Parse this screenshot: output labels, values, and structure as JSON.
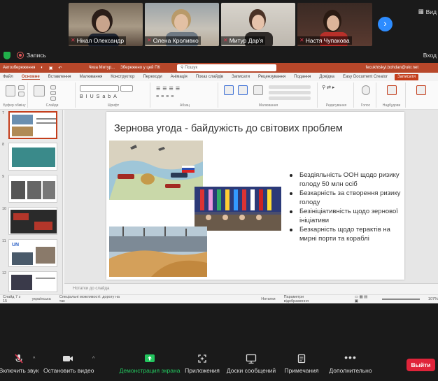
{
  "participants": [
    {
      "name": "Нікал Олександр",
      "muted": true
    },
    {
      "name": "Олена Кроливко",
      "muted": true
    },
    {
      "name": "Митур Дар'я",
      "muted": true
    },
    {
      "name": "Настя Чупакова",
      "muted": true
    }
  ],
  "view_label": "Вид",
  "record_label": "Запись",
  "exit_label": "Вход",
  "ppt": {
    "title_left": "Автозбереження",
    "doc_title": "Чиза Митур...",
    "save_loc": "Збережено у цей ПК",
    "search_placeholder": "Пошук",
    "user": "fecukhtskyi.bohdan@ukr.net",
    "menu": [
      "Файл",
      "Основне",
      "Вставлення",
      "Малювання",
      "Конструктор",
      "Переходи",
      "Анімація",
      "Показ слайдів",
      "Записати",
      "Рецензування",
      "Подання",
      "Довідка",
      "Easy Document Creator"
    ],
    "active_menu": "Основне",
    "share": "Записати",
    "ribbon_groups": [
      "Буфер обміну",
      "Слайди",
      "Шрифт",
      "Абзац",
      "Малювання",
      "Редагування",
      "Голос",
      "Надбудови"
    ],
    "thumb_numbers": [
      "7",
      "8",
      "9",
      "10",
      "11",
      "12"
    ],
    "slide_title": "Зернова угода - байдужість до світових проблем",
    "bullets": [
      "Бездіяльність ООН щодо ризику голоду 50 млн осіб",
      "Безкарність за створення ризику голоду",
      "Безініціативність щодо зернової ініціативи",
      "Безкарність щодо терактів на мирні порти та кораблі"
    ],
    "notes_placeholder": "Нотатки до слайда",
    "status": {
      "slide": "Слайд 7 з 15",
      "lang": "українська",
      "access": "Спеціальні можливості: дорогу на так",
      "notes": "Нотатки",
      "display": "Параметри відображення",
      "zoom": "107%"
    }
  },
  "toolbar": {
    "mute": "Включить звук",
    "video": "Остановить видео",
    "share": "Демонстрация экрана",
    "apps": "Приложения",
    "chat": "Доски сообщений",
    "notes": "Примечания",
    "more": "Дополнительно",
    "leave": "Выйти"
  },
  "colors": {
    "ppt_accent": "#b7472a",
    "zoom_blue": "#2d8cff",
    "share_green": "#23c55e",
    "leave_red": "#e0243a"
  }
}
